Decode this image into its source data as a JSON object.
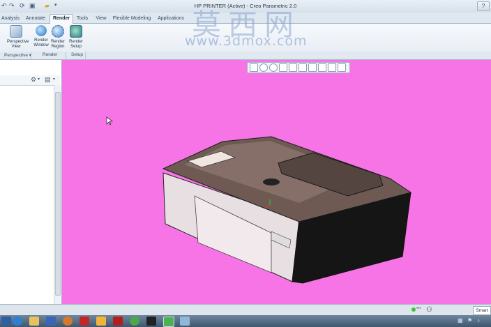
{
  "window": {
    "title": "HP PRINTER (Active) - Creo Parametric 2.0",
    "help_label": "?"
  },
  "tabs": [
    {
      "label": "Analysis"
    },
    {
      "label": "Annotate"
    },
    {
      "label": "Render",
      "active": true
    },
    {
      "label": "Tools"
    },
    {
      "label": "View"
    },
    {
      "label": "Flexible Modeling"
    },
    {
      "label": "Applications"
    }
  ],
  "ribbon": {
    "buttons": [
      {
        "label": "Perspective View",
        "icon": "perspective-view-icon"
      },
      {
        "label": "Render Window",
        "icon": "render-window-icon"
      },
      {
        "label": "Render Region",
        "icon": "render-region-icon"
      },
      {
        "label": "Render Setup",
        "icon": "render-setup-icon"
      }
    ],
    "groups": [
      {
        "label": "Perspective",
        "dropdown": "▾"
      },
      {
        "label": "Render"
      },
      {
        "label": "Setup"
      }
    ]
  },
  "watermark": {
    "chinese": "莫西网",
    "url": "www.3dmox.com"
  },
  "status": {
    "filter_value": "Smart"
  },
  "colors": {
    "viewport_background": "#f774e6",
    "ribbon_bg": "#f7f9fc",
    "taskbar_bg": "#4f6882",
    "status_led": "#3cc43c"
  },
  "view_toolbar": [
    "zoom-fit-icon",
    "zoom-in-icon",
    "zoom-out-icon",
    "repaint-icon",
    "saved-views-icon",
    "display-style-icon",
    "named-view-icon",
    "datum-display-icon",
    "spin-center-icon",
    "annotation-display-icon"
  ],
  "taskbar_items": [
    "start-icon",
    "ie-icon",
    "explorer-icon",
    "media-icon",
    "firefox-icon",
    "app-icon-red",
    "paint-icon",
    "pdf-icon",
    "chrome-icon",
    "terminal-icon",
    "creo-icon",
    "image-viewer-icon"
  ]
}
